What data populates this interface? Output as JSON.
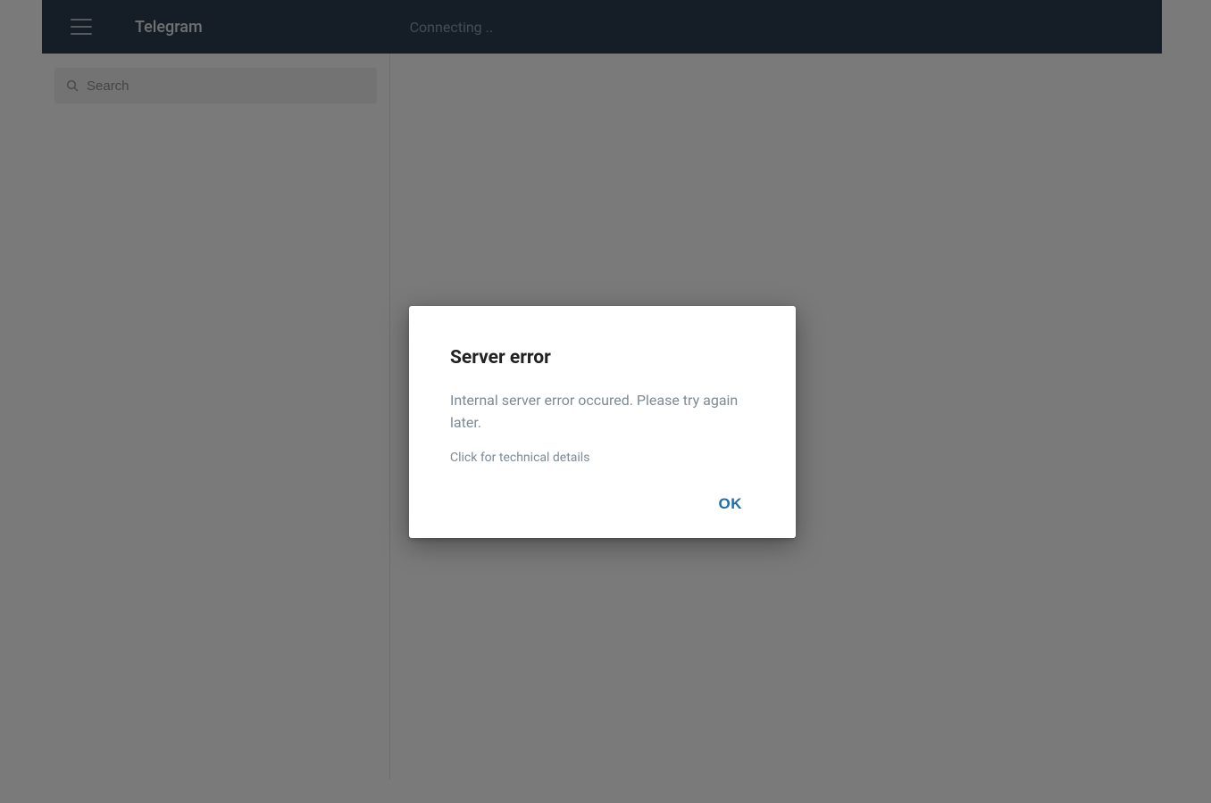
{
  "header": {
    "app_title": "Telegram",
    "status": "Connecting .."
  },
  "search": {
    "placeholder": "Search",
    "value": ""
  },
  "dialog": {
    "title": "Server error",
    "message": "Internal server error occured. Please try again later.",
    "details_hint": "Click for technical details",
    "ok_label": "OK"
  }
}
